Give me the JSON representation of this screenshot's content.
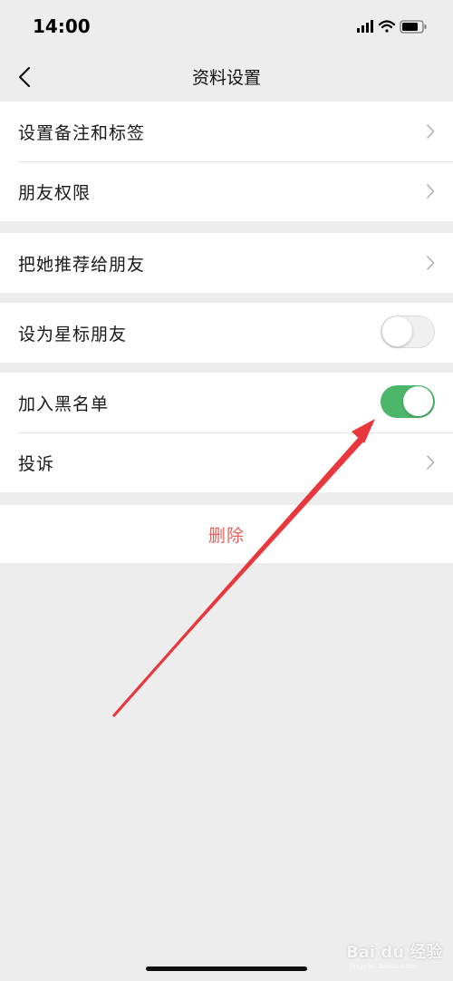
{
  "status_bar": {
    "time": "14:00"
  },
  "nav": {
    "title": "资料设置"
  },
  "group1": {
    "items": [
      {
        "label": "设置备注和标签"
      },
      {
        "label": "朋友权限"
      }
    ]
  },
  "group2": {
    "items": [
      {
        "label": "把她推荐给朋友"
      }
    ]
  },
  "group3": {
    "star": {
      "label": "设为星标朋友",
      "enabled": false
    }
  },
  "group4": {
    "blacklist": {
      "label": "加入黑名单",
      "enabled": true
    },
    "complain": {
      "label": "投诉"
    }
  },
  "delete": {
    "label": "删除"
  },
  "watermark": {
    "text": "Bai du 经验",
    "sub": "jingyan.baidu.com"
  },
  "colors": {
    "toggle_on": "#4cb76a",
    "delete_text": "#e5615e",
    "annotation_arrow": "#e8383d",
    "background": "#ededed"
  }
}
